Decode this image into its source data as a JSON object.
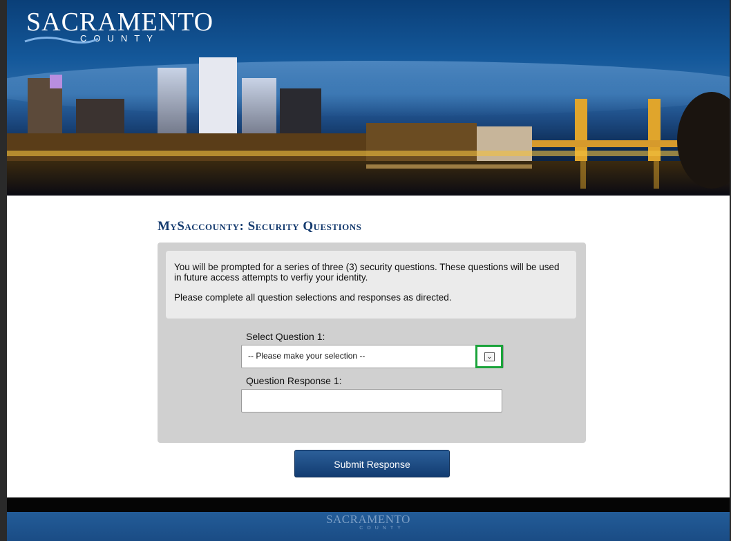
{
  "header": {
    "logo_main": "SACRAMENTO",
    "logo_sub": "COUNTY"
  },
  "main": {
    "title": "MySaccounty: Security Questions",
    "info_line_1": "You will be prompted for a series of three (3) security questions. These questions will be used in future access attempts to verfiy your identity.",
    "info_line_2": "Please complete all question selections and responses as directed.",
    "select_label": "Select Question 1:",
    "select_value": "-- Please make your selection --",
    "response_label": "Question Response 1:",
    "response_value": "",
    "submit_label": "Submit Response"
  },
  "footer": {
    "logo_main": "SACRAMENTO",
    "logo_sub": "COUNTY"
  },
  "colors": {
    "brand_blue": "#143a6e",
    "button_blue": "#1a4c85",
    "highlight_green": "#1aa33a",
    "panel_gray": "#d0d0d0"
  },
  "icons": {
    "dropdown": "chevron-down-icon"
  }
}
